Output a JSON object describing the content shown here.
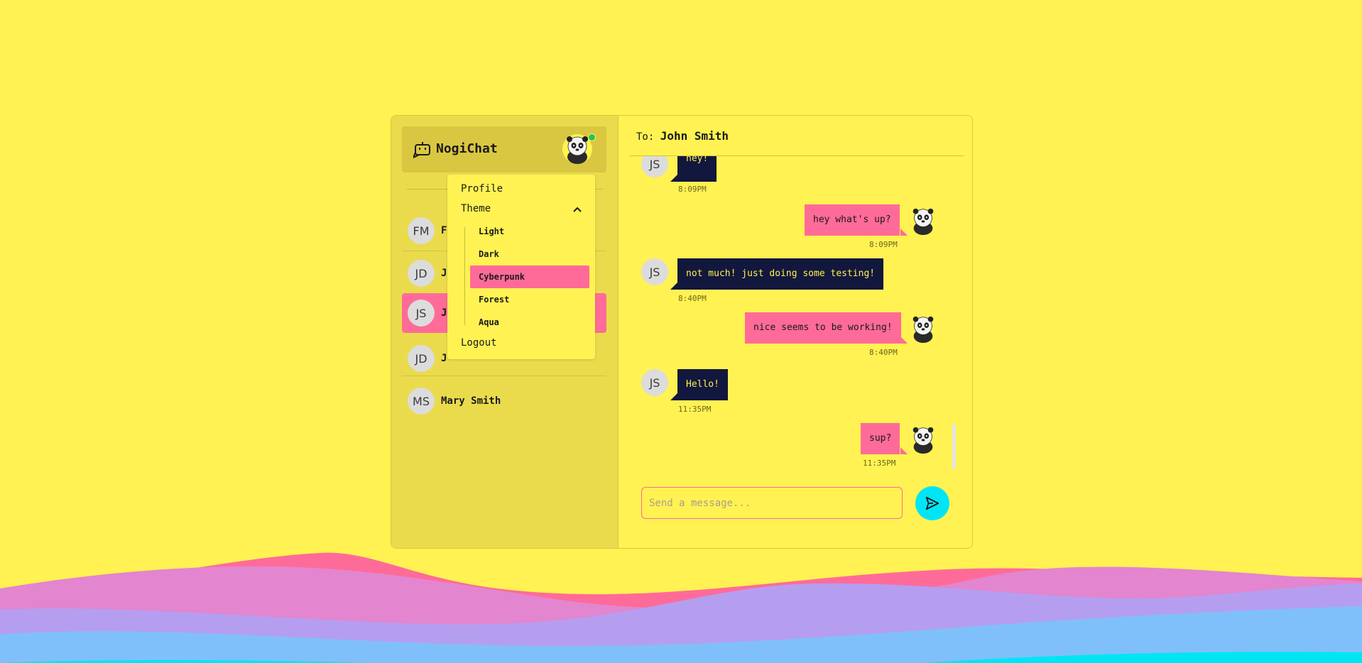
{
  "app": {
    "name": "NogiChat"
  },
  "colors": {
    "background": "#fff252",
    "accent": "#ff6b98",
    "dark": "#12173d",
    "send": "#00e5f5",
    "online": "#22c55e"
  },
  "user": {
    "avatar_icon": "panda-avatar-icon",
    "online": true
  },
  "menu": {
    "profile": "Profile",
    "theme": "Theme",
    "logout": "Logout",
    "themes": [
      {
        "label": "Light",
        "selected": false
      },
      {
        "label": "Dark",
        "selected": false
      },
      {
        "label": "Cyberpunk",
        "selected": true
      },
      {
        "label": "Forest",
        "selected": false
      },
      {
        "label": "Aqua",
        "selected": false
      }
    ]
  },
  "contacts": [
    {
      "initials": "FM",
      "name": "F",
      "active": false
    },
    {
      "initials": "JD",
      "name": "J",
      "active": false
    },
    {
      "initials": "JS",
      "name": "J",
      "active": true
    },
    {
      "initials": "JD",
      "name": "J",
      "active": false
    },
    {
      "initials": "MS",
      "name": "Mary Smith",
      "active": false
    }
  ],
  "chat": {
    "to_label": "To:",
    "recipient": "John Smith",
    "messages": [
      {
        "from": "them",
        "initials": "JS",
        "text": "hey!",
        "time": "8:09PM"
      },
      {
        "from": "me",
        "text": "hey what's up?",
        "time": "8:09PM"
      },
      {
        "from": "them",
        "initials": "JS",
        "text": "not much! just doing some testing!",
        "time": "8:40PM"
      },
      {
        "from": "me",
        "text": "nice seems to be working!",
        "time": "8:40PM"
      },
      {
        "from": "them",
        "initials": "JS",
        "text": "Hello!",
        "time": "11:35PM"
      },
      {
        "from": "me",
        "text": "sup?",
        "time": "11:35PM"
      }
    ],
    "input_placeholder": "Send a message...",
    "input_value": ""
  }
}
